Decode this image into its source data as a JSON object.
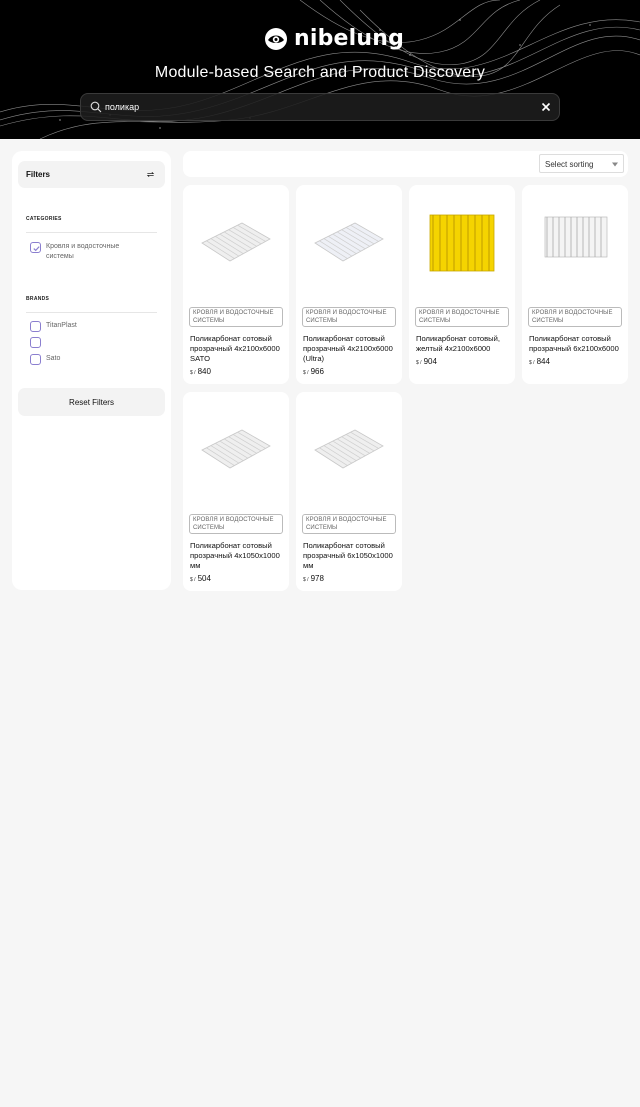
{
  "brand": {
    "name": "nibelung"
  },
  "hero": {
    "title": "Module-based Search and Product Discovery"
  },
  "search": {
    "value": "поликар"
  },
  "filters": {
    "title": "Filters",
    "categories_title": "CATEGORIES",
    "categories": [
      {
        "label": "Кровля и водосточные системы",
        "checked": true
      }
    ],
    "brands_title": "BRANDS",
    "brands": [
      {
        "label": "TitanPlast",
        "checked": false
      },
      {
        "label": "",
        "checked": false
      },
      {
        "label": "Sato",
        "checked": false
      }
    ],
    "reset_label": "Reset Filters"
  },
  "sort": {
    "label": "Select sorting"
  },
  "products": [
    {
      "category": "КРОВЛЯ И ВОДОСТОЧНЫЕ СИСТЕМЫ",
      "title": "Поликарбонат сотовый прозрачный 4x2100x6000 SATO",
      "currency": "$ /",
      "price": "840",
      "color": "clear"
    },
    {
      "category": "КРОВЛЯ И ВОДОСТОЧНЫЕ СИСТЕМЫ",
      "title": "Поликарбонат сотовый прозрачный 4x2100x6000 (Ultra)",
      "currency": "$ /",
      "price": "966",
      "color": "clear"
    },
    {
      "category": "КРОВЛЯ И ВОДОСТОЧНЫЕ СИСТЕМЫ",
      "title": "Поликарбонат сотовый, желтый 4x2100x6000",
      "currency": "$ /",
      "price": "904",
      "color": "yellow"
    },
    {
      "category": "КРОВЛЯ И ВОДОСТОЧНЫЕ СИСТЕМЫ",
      "title": "Поликарбонат сотовый прозрачный 6x2100x6000",
      "currency": "$ /",
      "price": "844",
      "color": "clear"
    },
    {
      "category": "КРОВЛЯ И ВОДОСТОЧНЫЕ СИСТЕМЫ",
      "title": "Поликарбонат сотовый прозрачный 4x1050x1000 мм",
      "currency": "$ /",
      "price": "504",
      "color": "clear"
    },
    {
      "category": "КРОВЛЯ И ВОДОСТОЧНЫЕ СИСТЕМЫ",
      "title": "Поликарбонат сотовый прозрачный 6x1050x1000 мм",
      "currency": "$ /",
      "price": "978",
      "color": "clear"
    }
  ],
  "colors": {
    "accent_checkbox": "#8b7fcf",
    "hero_bg": "#000000",
    "yellow_panel": "#f5d400"
  }
}
